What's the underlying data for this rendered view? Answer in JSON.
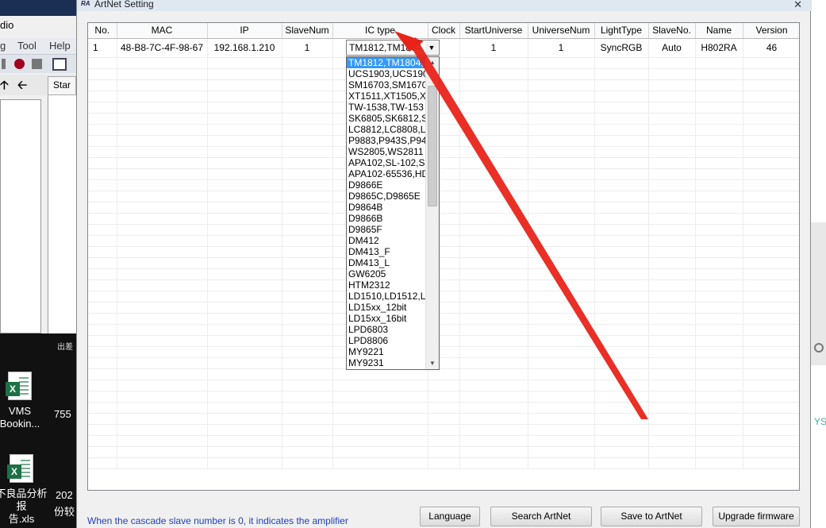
{
  "background_app": {
    "title": "dio",
    "menu": [
      "g",
      "Tool",
      "Help"
    ],
    "tab": "Star"
  },
  "desktop": {
    "icons": [
      {
        "label_line1": "VMS",
        "label_line2": "Bookin..."
      },
      {
        "label_line1": "不良品分析报",
        "label_line2": "告.xls"
      }
    ],
    "extra_texts": [
      "755",
      "202",
      "份较",
      "出差"
    ]
  },
  "right_edge_text": "YS",
  "dialog": {
    "title": "ArtNet Setting",
    "close_glyph": "✕",
    "columns": [
      "No.",
      "MAC",
      "IP",
      "SlaveNum",
      "IC type",
      "Clock",
      "StartUniverse",
      "UniverseNum",
      "LightType",
      "SlaveNo.",
      "Name",
      "Version"
    ],
    "rows": [
      {
        "no": "1",
        "mac": "48-B8-7C-4F-98-67",
        "ip": "192.168.1.210",
        "slave_num": "1",
        "ic_type": "TM1812,TM1804,",
        "clock": "",
        "start_universe": "1",
        "universe_num": "1",
        "light_type": "SyncRGB",
        "slave_no": "Auto",
        "name": "H802RA",
        "version": "46"
      }
    ],
    "ic_type_options": [
      "TM1812,TM1804,",
      "UCS1903,UCS1909",
      "SM16703,SM1670",
      "XT1511,XT1505,X",
      "TW-1538,TW-153",
      "SK6805,SK6812,S",
      "LC8812,LC8808,LC",
      "P9883,P943S,P94",
      "WS2805,WS2811",
      "APA102,SL-102,SI",
      "APA102-65536,HD",
      "D9866E",
      "D9865C,D9865E",
      "D9864B",
      "D9866B",
      "D9865F",
      "DM412",
      "DM413_F",
      "DM413_L",
      "GW6205",
      "HTM2312",
      "LD1510,LD1512,L",
      "LD15xx_12bit",
      "LD15xx_16bit",
      "LPD6803",
      "LPD8806",
      "MY9221",
      "MY9231"
    ],
    "selected_option_index": 0,
    "note": "When the cascade slave number is 0, it indicates the amplifier",
    "buttons": {
      "language": "Language",
      "search": "Search ArtNet",
      "save": "Save to ArtNet",
      "upgrade": "Upgrade firmware"
    }
  },
  "colors": {
    "selection": "#3399ff",
    "annotation_arrow": "#e8241a",
    "note_text": "#2040c0"
  }
}
